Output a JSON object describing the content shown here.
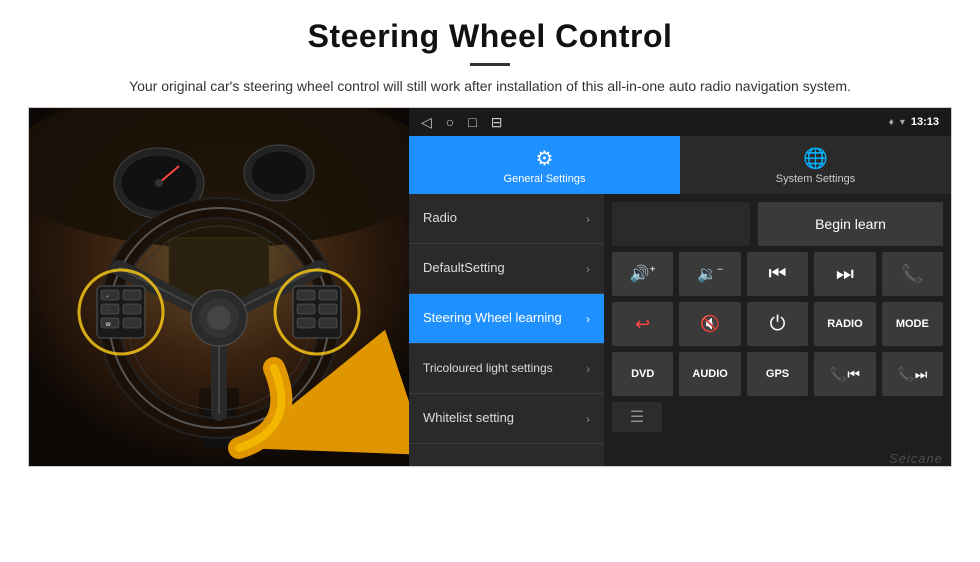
{
  "header": {
    "title": "Steering Wheel Control",
    "description": "Your original car's steering wheel control will still work after installation of this all-in-one auto radio navigation system."
  },
  "status_bar": {
    "nav_back": "◁",
    "nav_home": "○",
    "nav_recent": "□",
    "nav_extra": "⊟",
    "location_icon": "♦",
    "signal_icon": "▾",
    "time": "13:13"
  },
  "tabs": [
    {
      "id": "general",
      "label": "General Settings",
      "active": true
    },
    {
      "id": "system",
      "label": "System Settings",
      "active": false
    }
  ],
  "menu_items": [
    {
      "id": "radio",
      "label": "Radio",
      "active": false
    },
    {
      "id": "default",
      "label": "DefaultSetting",
      "active": false
    },
    {
      "id": "steering",
      "label": "Steering Wheel learning",
      "active": true
    },
    {
      "id": "tricoloured",
      "label": "Tricoloured light settings",
      "active": false
    },
    {
      "id": "whitelist",
      "label": "Whitelist setting",
      "active": false
    }
  ],
  "right_panel": {
    "begin_learn_label": "Begin learn",
    "buttons_row1": [
      {
        "id": "vol-up",
        "symbol": "🔊+",
        "label": "Vol+"
      },
      {
        "id": "vol-down",
        "symbol": "🔉-",
        "label": "Vol-"
      },
      {
        "id": "prev",
        "symbol": "⏮",
        "label": "Prev"
      },
      {
        "id": "next",
        "symbol": "⏭",
        "label": "Next"
      },
      {
        "id": "call",
        "symbol": "📞",
        "label": "Call"
      }
    ],
    "buttons_row2": [
      {
        "id": "hang-up",
        "symbol": "↩",
        "label": "HangUp"
      },
      {
        "id": "mute",
        "symbol": "🔇x",
        "label": "Mute"
      },
      {
        "id": "power",
        "symbol": "⏻",
        "label": "Power"
      },
      {
        "id": "radio-btn",
        "text": "RADIO",
        "label": "Radio"
      },
      {
        "id": "mode-btn",
        "text": "MODE",
        "label": "Mode"
      }
    ],
    "buttons_row3": [
      {
        "id": "dvd",
        "text": "DVD",
        "label": "DVD"
      },
      {
        "id": "audio",
        "text": "AUDIO",
        "label": "Audio"
      },
      {
        "id": "gps",
        "text": "GPS",
        "label": "GPS"
      },
      {
        "id": "tel-prev",
        "symbol": "📞⏮",
        "label": "Tel+Prev"
      },
      {
        "id": "tel-next",
        "symbol": "📞⏭",
        "label": "Tel+Next"
      }
    ]
  },
  "watermark": "Seicane"
}
